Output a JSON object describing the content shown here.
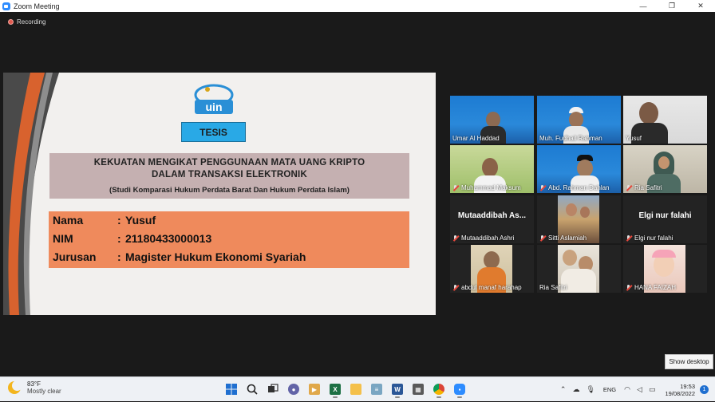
{
  "window": {
    "title": "Zoom Meeting",
    "controls": {
      "minimize": "—",
      "maximize": "❐",
      "close": "✕"
    }
  },
  "recording": {
    "label": "Recording",
    "color": "#e25a4f"
  },
  "slide": {
    "badge": "TESIS",
    "title_line1": "KEKUATAN MENGIKAT PENGGUNAAN MATA UANG KRIPTO",
    "title_line2": "DALAM TRANSAKSI ELEKTRONIK",
    "subtitle": "(Studi Komparasi Hukum Perdata Barat Dan Hukum Perdata Islam)",
    "fields": [
      {
        "label": "Nama",
        "sep": ":",
        "value": "Yusuf"
      },
      {
        "label": "NIM",
        "sep": ":",
        "value": "21180433000013"
      },
      {
        "label": "Jurusan",
        "sep": ":",
        "value": "Magister Hukum Ekonomi Syariah"
      }
    ],
    "colors": {
      "title_box": "#c5b0b1",
      "info_box": "#ef8a5c",
      "badge": "#29a9e6"
    }
  },
  "participants": [
    {
      "name": "Umar Al Haddad",
      "muted": false,
      "label_only": false
    },
    {
      "name": "Muh. Fudhail Rahman",
      "muted": false,
      "label_only": false
    },
    {
      "name": "Yusuf",
      "muted": false,
      "label_only": false
    },
    {
      "name": "Muhammad Maksum",
      "muted": true,
      "label_only": false
    },
    {
      "name": "Abd. Rahman Dahlan",
      "muted": true,
      "label_only": false
    },
    {
      "name": "Ria Safitri",
      "muted": true,
      "label_only": false,
      "active": true
    },
    {
      "name": "Mutaaddibah Ashri",
      "muted": true,
      "label_only": true,
      "display": "Mutaaddibah As..."
    },
    {
      "name": "Sitti Aslamiah",
      "muted": true,
      "label_only": false
    },
    {
      "name": "Elgi nur falahi",
      "muted": true,
      "label_only": true,
      "display": "Elgi nur falahi"
    },
    {
      "name": "abdul manaf harahap",
      "muted": true,
      "label_only": false
    },
    {
      "name": "Ria Safitri",
      "muted": false,
      "label_only": false
    },
    {
      "name": "HANA FAIZAH",
      "muted": true,
      "label_only": false
    }
  ],
  "show_desktop": "Show desktop",
  "taskbar": {
    "weather": {
      "temp": "83°F",
      "desc": "Mostly clear",
      "icon": "moon-icon"
    },
    "apps": [
      "windows-start",
      "search",
      "task-view",
      "teams-chat",
      "media-player",
      "excel",
      "file-explorer",
      "notepad",
      "word",
      "calculator",
      "chrome",
      "zoom"
    ],
    "tray": {
      "lang": "ENG",
      "time": "19:53",
      "date": "19/08/2022",
      "notifications": "1"
    }
  }
}
